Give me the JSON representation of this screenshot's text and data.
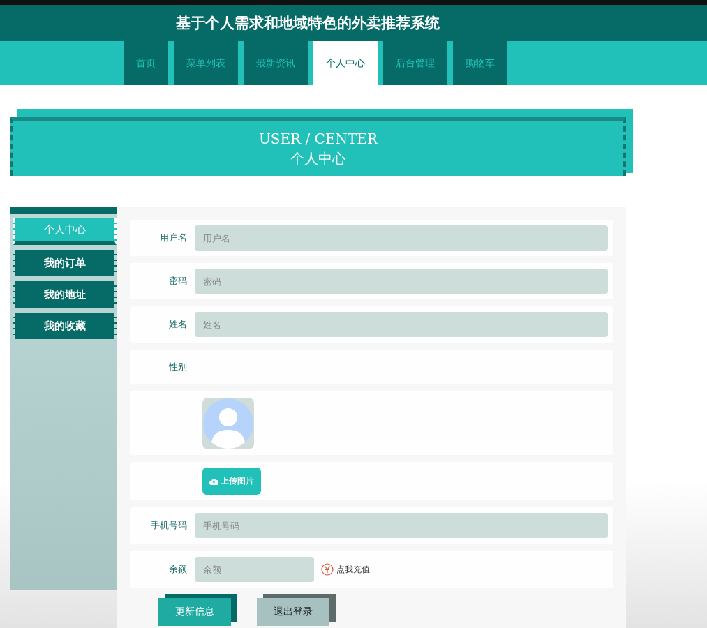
{
  "header": {
    "title": "基于个人需求和地域特色的外卖推荐系统"
  },
  "nav": [
    {
      "label": "首页",
      "selected": false
    },
    {
      "label": "菜单列表",
      "selected": false
    },
    {
      "label": "最新资讯",
      "selected": false
    },
    {
      "label": "个人中心",
      "selected": true
    },
    {
      "label": "后台管理",
      "selected": false
    },
    {
      "label": "购物车",
      "selected": false
    }
  ],
  "banner": {
    "title_en": "USER / CENTER",
    "title_cn": "个人中心"
  },
  "sidebar": [
    {
      "label": "个人中心",
      "selected": true
    },
    {
      "label": "我的订单",
      "selected": false
    },
    {
      "label": "我的地址",
      "selected": false
    },
    {
      "label": "我的收藏",
      "selected": false
    }
  ],
  "form": [
    {
      "kind": "input",
      "label": "用户名",
      "placeholder": "用户名"
    },
    {
      "kind": "input",
      "label": "密码",
      "placeholder": "密码"
    },
    {
      "kind": "input",
      "label": "姓名",
      "placeholder": "姓名"
    },
    {
      "kind": "text",
      "label": "性别"
    },
    {
      "kind": "avatar"
    },
    {
      "kind": "upload",
      "button": "上传图片"
    },
    {
      "kind": "input",
      "label": "手机号码",
      "placeholder": "手机号码"
    },
    {
      "kind": "balance",
      "label": "余额",
      "placeholder": "余额",
      "link": "点我充值"
    }
  ],
  "buttons": [
    {
      "kind": "primary",
      "label": "更新信息"
    },
    {
      "kind": "secondary",
      "label": "退出登录"
    }
  ]
}
